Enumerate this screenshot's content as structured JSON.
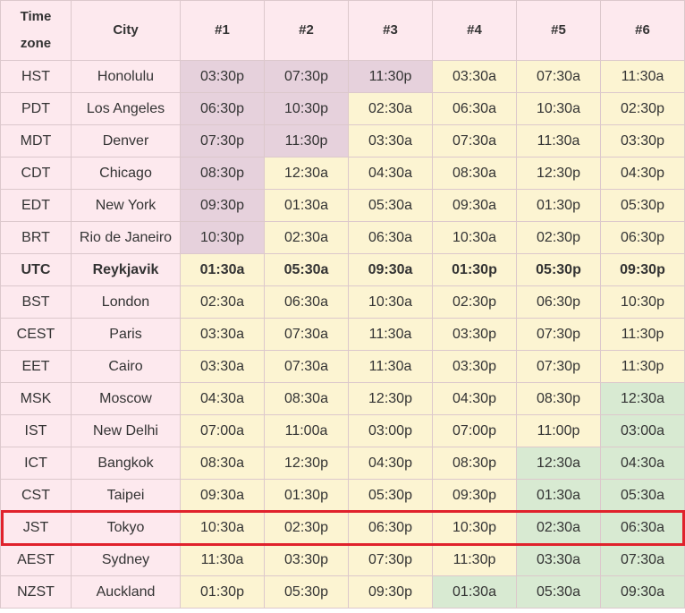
{
  "table": {
    "headers": [
      "Time zone",
      "City",
      "#1",
      "#2",
      "#3",
      "#4",
      "#5",
      "#6"
    ],
    "rows": [
      {
        "tz": "HST",
        "city": "Honolulu",
        "times": [
          "03:30p",
          "07:30p",
          "11:30p",
          "03:30a",
          "07:30a",
          "11:30a"
        ],
        "shade": [
          "n",
          "n",
          "n",
          "d",
          "d",
          "d"
        ]
      },
      {
        "tz": "PDT",
        "city": "Los Angeles",
        "times": [
          "06:30p",
          "10:30p",
          "02:30a",
          "06:30a",
          "10:30a",
          "02:30p"
        ],
        "shade": [
          "n",
          "n",
          "d",
          "d",
          "d",
          "d"
        ]
      },
      {
        "tz": "MDT",
        "city": "Denver",
        "times": [
          "07:30p",
          "11:30p",
          "03:30a",
          "07:30a",
          "11:30a",
          "03:30p"
        ],
        "shade": [
          "n",
          "n",
          "d",
          "d",
          "d",
          "d"
        ]
      },
      {
        "tz": "CDT",
        "city": "Chicago",
        "times": [
          "08:30p",
          "12:30a",
          "04:30a",
          "08:30a",
          "12:30p",
          "04:30p"
        ],
        "shade": [
          "n",
          "d",
          "d",
          "d",
          "d",
          "d"
        ]
      },
      {
        "tz": "EDT",
        "city": "New York",
        "times": [
          "09:30p",
          "01:30a",
          "05:30a",
          "09:30a",
          "01:30p",
          "05:30p"
        ],
        "shade": [
          "n",
          "d",
          "d",
          "d",
          "d",
          "d"
        ]
      },
      {
        "tz": "BRT",
        "city": "Rio de Janeiro",
        "times": [
          "10:30p",
          "02:30a",
          "06:30a",
          "10:30a",
          "02:30p",
          "06:30p"
        ],
        "shade": [
          "n",
          "d",
          "d",
          "d",
          "d",
          "d"
        ]
      },
      {
        "tz": "UTC",
        "city": "Reykjavik",
        "times": [
          "01:30a",
          "05:30a",
          "09:30a",
          "01:30p",
          "05:30p",
          "09:30p"
        ],
        "shade": [
          "d",
          "d",
          "d",
          "d",
          "d",
          "d"
        ],
        "bold": true
      },
      {
        "tz": "BST",
        "city": "London",
        "times": [
          "02:30a",
          "06:30a",
          "10:30a",
          "02:30p",
          "06:30p",
          "10:30p"
        ],
        "shade": [
          "d",
          "d",
          "d",
          "d",
          "d",
          "d"
        ]
      },
      {
        "tz": "CEST",
        "city": "Paris",
        "times": [
          "03:30a",
          "07:30a",
          "11:30a",
          "03:30p",
          "07:30p",
          "11:30p"
        ],
        "shade": [
          "d",
          "d",
          "d",
          "d",
          "d",
          "d"
        ]
      },
      {
        "tz": "EET",
        "city": "Cairo",
        "times": [
          "03:30a",
          "07:30a",
          "11:30a",
          "03:30p",
          "07:30p",
          "11:30p"
        ],
        "shade": [
          "d",
          "d",
          "d",
          "d",
          "d",
          "d"
        ]
      },
      {
        "tz": "MSK",
        "city": "Moscow",
        "times": [
          "04:30a",
          "08:30a",
          "12:30p",
          "04:30p",
          "08:30p",
          "12:30a"
        ],
        "shade": [
          "d",
          "d",
          "d",
          "d",
          "d",
          "m"
        ]
      },
      {
        "tz": "IST",
        "city": "New Delhi",
        "times": [
          "07:00a",
          "11:00a",
          "03:00p",
          "07:00p",
          "11:00p",
          "03:00a"
        ],
        "shade": [
          "d",
          "d",
          "d",
          "d",
          "d",
          "m"
        ]
      },
      {
        "tz": "ICT",
        "city": "Bangkok",
        "times": [
          "08:30a",
          "12:30p",
          "04:30p",
          "08:30p",
          "12:30a",
          "04:30a"
        ],
        "shade": [
          "d",
          "d",
          "d",
          "d",
          "m",
          "m"
        ]
      },
      {
        "tz": "CST",
        "city": "Taipei",
        "times": [
          "09:30a",
          "01:30p",
          "05:30p",
          "09:30p",
          "01:30a",
          "05:30a"
        ],
        "shade": [
          "d",
          "d",
          "d",
          "d",
          "m",
          "m"
        ]
      },
      {
        "tz": "JST",
        "city": "Tokyo",
        "times": [
          "10:30a",
          "02:30p",
          "06:30p",
          "10:30p",
          "02:30a",
          "06:30a"
        ],
        "shade": [
          "d",
          "d",
          "d",
          "d",
          "m",
          "m"
        ],
        "highlighted": true
      },
      {
        "tz": "AEST",
        "city": "Sydney",
        "times": [
          "11:30a",
          "03:30p",
          "07:30p",
          "11:30p",
          "03:30a",
          "07:30a"
        ],
        "shade": [
          "d",
          "d",
          "d",
          "d",
          "m",
          "m"
        ]
      },
      {
        "tz": "NZST",
        "city": "Auckland",
        "times": [
          "01:30p",
          "05:30p",
          "09:30p",
          "01:30a",
          "05:30a",
          "09:30a"
        ],
        "shade": [
          "d",
          "d",
          "d",
          "m",
          "m",
          "m"
        ]
      }
    ]
  },
  "colors": {
    "header_bg": "#fde9ee",
    "night": "#e6d1dc",
    "day": "#fcf4d2",
    "early_morning": "#d8ead2",
    "highlight_border": "#e0222c"
  }
}
